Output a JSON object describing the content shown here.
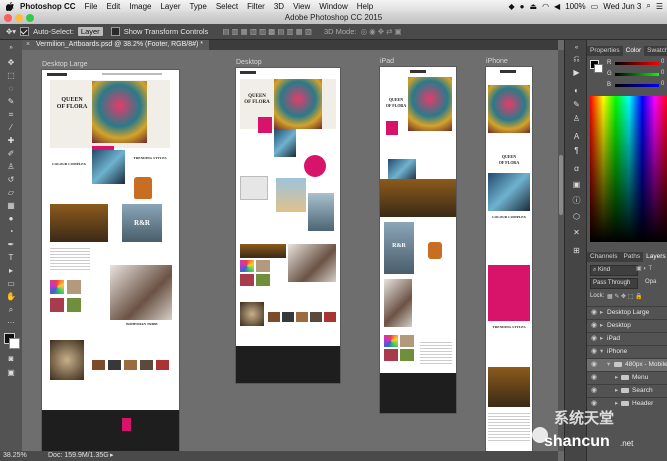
{
  "menubar": {
    "app_name": "Photoshop CC",
    "items": [
      "File",
      "Edit",
      "Image",
      "Layer",
      "Type",
      "Select",
      "Filter",
      "3D",
      "View",
      "Window",
      "Help"
    ],
    "battery": "100%",
    "datetime": "Wed Jun 3"
  },
  "window": {
    "title": "Adobe Photoshop CC 2015"
  },
  "options_bar": {
    "auto_select_label": "Auto-Select:",
    "auto_select_value": "Layer",
    "transform_label": "Show Transform Controls",
    "mode_label": "3D Mode:"
  },
  "document_tab": {
    "title": "Vermilion_Artboards.psd @ 38.2% (Footer, RGB/8#) *"
  },
  "artboards": [
    {
      "label": "Desktop Large"
    },
    {
      "label": "Desktop"
    },
    {
      "label": "iPad"
    },
    {
      "label": "iPhone"
    }
  ],
  "site": {
    "headline_1": "QUEEN",
    "headline_2": "OF FLORA",
    "trending": "TRENDING STYLES",
    "colour": "COLOUR COMPLEX",
    "rr": "R&R",
    "bohemian": "BOHEMIAN TRIBE"
  },
  "status_bar": {
    "zoom": "38.25%",
    "doc": "Doc: 159.9M/1.35G"
  },
  "color_panel": {
    "tabs": [
      "Properties",
      "Color",
      "Swatches"
    ],
    "active": "Color",
    "sliders": [
      "R",
      "G",
      "B"
    ],
    "values": [
      "0",
      "0",
      "0"
    ]
  },
  "layers_panel": {
    "tabs": [
      "Channels",
      "Paths",
      "Layers"
    ],
    "active": "Layers",
    "filter": "Kind",
    "blend_mode": "Pass Through",
    "opacity_label": "Opa",
    "lock_label": "Lock:",
    "layers": [
      {
        "name": "Desktop Large",
        "indent": 0
      },
      {
        "name": "Desktop",
        "indent": 0
      },
      {
        "name": "iPad",
        "indent": 0
      },
      {
        "name": "iPhone",
        "indent": 0
      },
      {
        "name": "480px - Mobile",
        "indent": 1
      },
      {
        "name": "Menu",
        "indent": 2
      },
      {
        "name": "Search",
        "indent": 2
      },
      {
        "name": "Header",
        "indent": 2
      }
    ]
  },
  "watermark": {
    "line1": "系统天堂",
    "line2": "shancun",
    "suffix": ".net"
  },
  "colors": {
    "accent_magenta": "#d8146a",
    "panel": "#535353",
    "canvas": "#6e6e6e"
  }
}
